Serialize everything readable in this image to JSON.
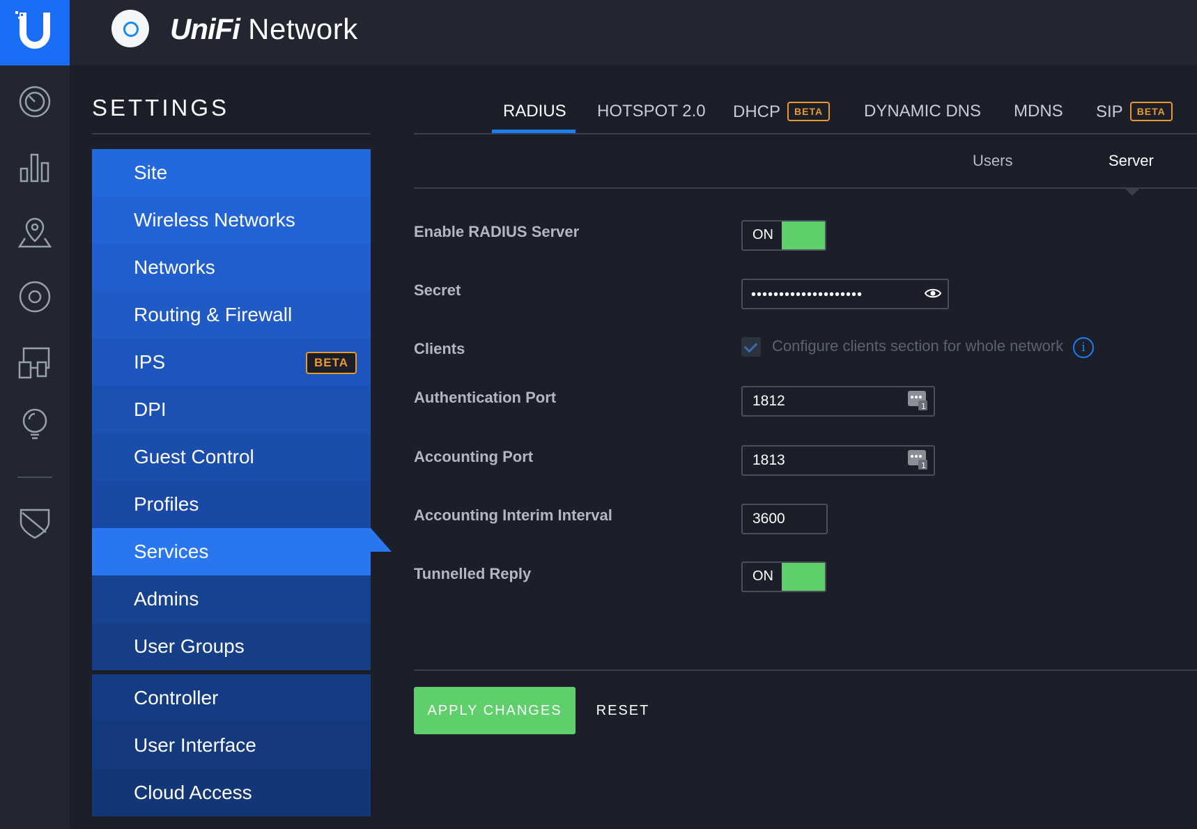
{
  "header": {
    "brand_logo": "ubiquiti-u-logo",
    "app_title_brand": "UniFi",
    "app_title_rest": "Network"
  },
  "rail": {
    "items": [
      "dashboard-icon",
      "statistics-icon",
      "map-icon",
      "devices-icon",
      "clients-icon",
      "insights-icon",
      "threat-management-icon"
    ]
  },
  "settings": {
    "title": "SETTINGS",
    "menu": [
      {
        "label": "Site"
      },
      {
        "label": "Wireless Networks"
      },
      {
        "label": "Networks"
      },
      {
        "label": "Routing & Firewall"
      },
      {
        "label": "IPS",
        "badge": "BETA"
      },
      {
        "label": "DPI"
      },
      {
        "label": "Guest Control"
      },
      {
        "label": "Profiles"
      },
      {
        "label": "Services",
        "active": true
      },
      {
        "label": "Admins"
      },
      {
        "label": "User Groups"
      },
      {
        "label": "Controller"
      },
      {
        "label": "User Interface"
      },
      {
        "label": "Cloud Access"
      }
    ]
  },
  "tabs": [
    {
      "label": "RADIUS",
      "active": true
    },
    {
      "label": "HOTSPOT 2.0"
    },
    {
      "label": "DHCP",
      "badge": "BETA"
    },
    {
      "label": "DYNAMIC DNS"
    },
    {
      "label": "MDNS"
    },
    {
      "label": "SIP",
      "badge": "BETA"
    }
  ],
  "subtabs": [
    {
      "label": "Users"
    },
    {
      "label": "Server",
      "active": true
    }
  ],
  "form": {
    "enable_radius_label": "Enable RADIUS Server",
    "enable_radius_state": "ON",
    "secret_label": "Secret",
    "secret_value": "••••••••••••••••••••",
    "clients_label": "Clients",
    "clients_checkbox_label": "Configure clients section for whole network",
    "auth_port_label": "Authentication Port",
    "auth_port_value": "1812",
    "acct_port_label": "Accounting Port",
    "acct_port_value": "1813",
    "interim_label": "Accounting Interim Interval",
    "interim_value": "3600",
    "tunnelled_label": "Tunnelled Reply",
    "tunnelled_state": "ON",
    "info_glyph": "i"
  },
  "actions": {
    "apply_label": "APPLY CHANGES",
    "reset_label": "RESET"
  },
  "colors": {
    "accent_blue": "#1a6ef5",
    "menu_blue": "#2a75f0",
    "toggle_green": "#5fcf6b",
    "beta_orange": "#e89a2c",
    "background": "#1c1f29"
  }
}
